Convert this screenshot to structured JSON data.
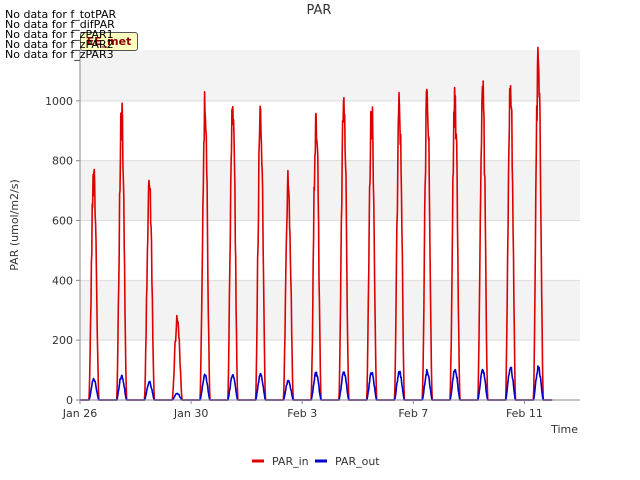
{
  "notices": [
    "No data for f_totPAR",
    "No data for f_difPAR",
    "No data for f_zPAR1",
    "No data for f_zPAR2",
    "No data for f_zPAR3"
  ],
  "badge_label": "EE_met",
  "chart_data": {
    "type": "line",
    "title": "PAR",
    "xlabel": "Time",
    "ylabel": "PAR (umol/m2/s)",
    "ylim": [
      0,
      1170
    ],
    "xlim": [
      "2021-01-26",
      "2021-02-13"
    ],
    "yticks": [
      0,
      200,
      400,
      600,
      800,
      1000
    ],
    "xticks": [
      {
        "date": "2021-01-26",
        "label": "Jan 26"
      },
      {
        "date": "2021-01-30",
        "label": "Jan 30"
      },
      {
        "date": "2021-02-03",
        "label": "Feb 3"
      },
      {
        "date": "2021-02-07",
        "label": "Feb 7"
      },
      {
        "date": "2021-02-11",
        "label": "Feb 11"
      }
    ],
    "grid": true,
    "legend_position": "bottom-center",
    "series": [
      {
        "name": "PAR_in",
        "color": "#dd0000",
        "daily_peaks": [
          {
            "date": "2021-01-26",
            "value": 760
          },
          {
            "date": "2021-01-27",
            "value": 930
          },
          {
            "date": "2021-01-28",
            "value": 715
          },
          {
            "date": "2021-01-29",
            "value": 270
          },
          {
            "date": "2021-01-30",
            "value": 960
          },
          {
            "date": "2021-01-31",
            "value": 980
          },
          {
            "date": "2021-02-01",
            "value": 970
          },
          {
            "date": "2021-02-02",
            "value": 715
          },
          {
            "date": "2021-02-03",
            "value": 955
          },
          {
            "date": "2021-02-04",
            "value": 1010
          },
          {
            "date": "2021-02-05",
            "value": 960
          },
          {
            "date": "2021-02-06",
            "value": 985
          },
          {
            "date": "2021-02-07",
            "value": 1030
          },
          {
            "date": "2021-02-08",
            "value": 1005
          },
          {
            "date": "2021-02-09",
            "value": 995
          },
          {
            "date": "2021-02-10",
            "value": 1050
          },
          {
            "date": "2021-02-11",
            "value": 1135
          }
        ]
      },
      {
        "name": "PAR_out",
        "color": "#0000cc",
        "daily_peaks": [
          {
            "date": "2021-01-26",
            "value": 68
          },
          {
            "date": "2021-01-27",
            "value": 82
          },
          {
            "date": "2021-01-28",
            "value": 58
          },
          {
            "date": "2021-01-29",
            "value": 22
          },
          {
            "date": "2021-01-30",
            "value": 82
          },
          {
            "date": "2021-01-31",
            "value": 84
          },
          {
            "date": "2021-02-01",
            "value": 88
          },
          {
            "date": "2021-02-02",
            "value": 65
          },
          {
            "date": "2021-02-03",
            "value": 90
          },
          {
            "date": "2021-02-04",
            "value": 90
          },
          {
            "date": "2021-02-05",
            "value": 90
          },
          {
            "date": "2021-02-06",
            "value": 92
          },
          {
            "date": "2021-02-07",
            "value": 95
          },
          {
            "date": "2021-02-08",
            "value": 100
          },
          {
            "date": "2021-02-09",
            "value": 100
          },
          {
            "date": "2021-02-10",
            "value": 108
          },
          {
            "date": "2021-02-11",
            "value": 108
          }
        ]
      }
    ]
  }
}
